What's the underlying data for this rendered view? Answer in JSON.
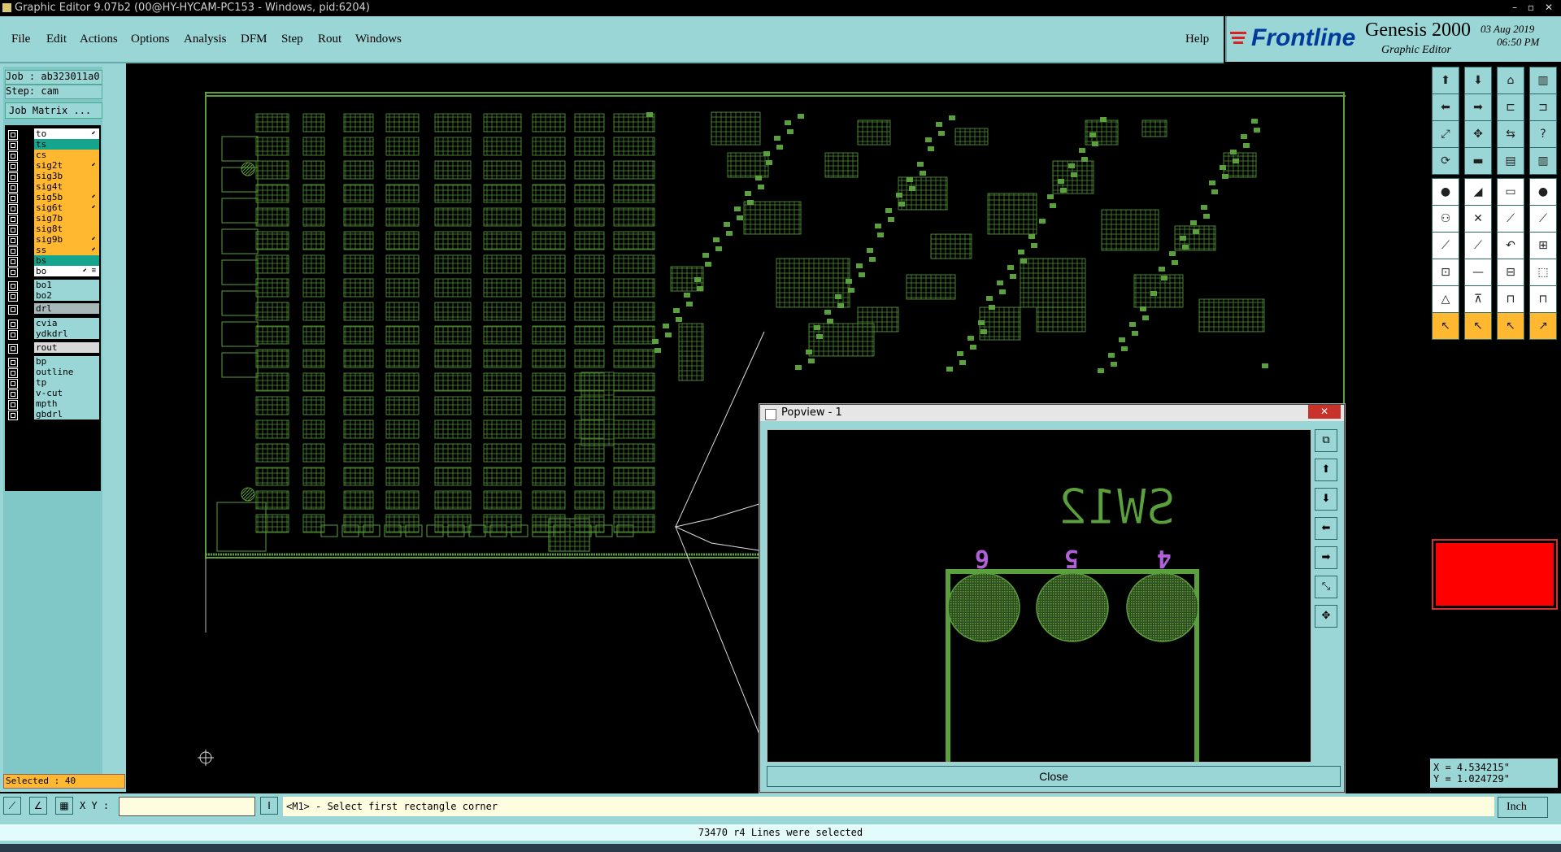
{
  "window": {
    "title": "Graphic Editor 9.07b2 (00@HY-HYCAM-PC153 - Windows, pid:6204)"
  },
  "menu": {
    "items": [
      "File",
      "Edit",
      "Actions",
      "Options",
      "Analysis",
      "DFM",
      "Step",
      "Rout",
      "Windows"
    ],
    "help": "Help"
  },
  "branding": {
    "logo": "Frontline",
    "product": "Genesis 2000",
    "subtitle": "Graphic Editor",
    "date": "03 Aug 2019",
    "time": "06:50 PM"
  },
  "job": {
    "job_line": "Job : ab323011a0",
    "step_line": "Step: cam",
    "matrix_button": "Job Matrix ..."
  },
  "layers": [
    {
      "name": "to",
      "color": "#ffffff",
      "flag": "⬋"
    },
    {
      "name": "ts",
      "color": "#14a58c",
      "flag": ""
    },
    {
      "name": "cs",
      "color": "#ffb830",
      "flag": ""
    },
    {
      "name": "sig2t",
      "color": "#ffb830",
      "flag": "⬋"
    },
    {
      "name": "sig3b",
      "color": "#ffb830",
      "flag": ""
    },
    {
      "name": "sig4t",
      "color": "#ffb830",
      "flag": ""
    },
    {
      "name": "sig5b",
      "color": "#ffb830",
      "flag": "⬋"
    },
    {
      "name": "sig6t",
      "color": "#ffb830",
      "flag": "⬋"
    },
    {
      "name": "sig7b",
      "color": "#ffb830",
      "flag": ""
    },
    {
      "name": "sig8t",
      "color": "#ffb830",
      "flag": ""
    },
    {
      "name": "sig9b",
      "color": "#ffb830",
      "flag": "⬋"
    },
    {
      "name": "ss",
      "color": "#ffb830",
      "flag": "⬋"
    },
    {
      "name": "bs",
      "color": "#14a58c",
      "flag": ""
    },
    {
      "name": "bo",
      "color": "#ffffff",
      "flag": "⬋ ≡"
    },
    {
      "name": "bo1",
      "color": "#9ad6d6",
      "flag": ""
    },
    {
      "name": "bo2",
      "color": "#9ad6d6",
      "flag": ""
    },
    {
      "name": "drl",
      "color": "#a8b8b8",
      "flag": ""
    },
    {
      "name": "cvia",
      "color": "#9ad6d6",
      "flag": ""
    },
    {
      "name": "ydkdrl",
      "color": "#9ad6d6",
      "flag": ""
    },
    {
      "name": "rout",
      "color": "#d8d8d8",
      "flag": ""
    },
    {
      "name": "bp",
      "color": "#9ad6d6",
      "flag": ""
    },
    {
      "name": "outline",
      "color": "#9ad6d6",
      "flag": ""
    },
    {
      "name": "tp",
      "color": "#9ad6d6",
      "flag": ""
    },
    {
      "name": "v-cut",
      "color": "#9ad6d6",
      "flag": ""
    },
    {
      "name": "mpth",
      "color": "#9ad6d6",
      "flag": ""
    },
    {
      "name": "gbdrl",
      "color": "#9ad6d6",
      "flag": ""
    }
  ],
  "selection": {
    "label": "Selected : 40"
  },
  "popview": {
    "title": "Popview - 1",
    "component_label": "SW12",
    "pin_labels": [
      "6",
      "5",
      "4"
    ],
    "close_label": "Close"
  },
  "coords": {
    "x": "X = 4.534215\"",
    "y": "Y = 1.024729\""
  },
  "command": {
    "xy_label": "X Y :",
    "xy_value": "",
    "prompt": "<M1> - Select first rectangle corner",
    "unit": "Inch"
  },
  "status": {
    "text": "73470 r4 Lines were selected"
  },
  "colors": {
    "panel": "#9ad6d6",
    "board": "#5aa03c",
    "highlight": "#ff0000",
    "pin_label": "#b060d8"
  }
}
